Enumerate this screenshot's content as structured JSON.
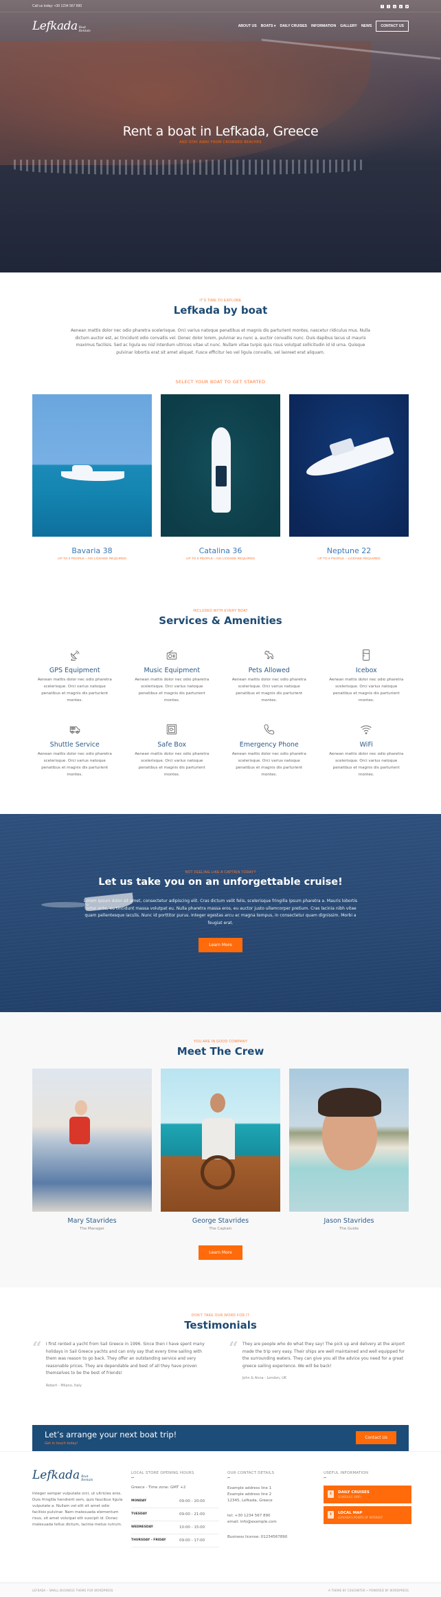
{
  "topbar": {
    "call": "Call us today: +30 1234 567 890",
    "socials": [
      "facebook-icon",
      "twitter-icon",
      "instagram-icon",
      "youtube-icon",
      "email-icon"
    ]
  },
  "brand": {
    "main": "Lefkada",
    "sub1": "Boat",
    "sub2": "Rentals"
  },
  "nav": {
    "items": [
      "ABOUT US",
      "BOATS",
      "DAILY CRUISES",
      "INFORMATION",
      "GALLERY",
      "NEWS"
    ],
    "boats_caret": "▾",
    "contact": "CONTACT US"
  },
  "hero": {
    "title": "Rent a boat in Lefkada, Greece",
    "subtitle": "AND STAY AWAY FROM CROWDED BEACHES"
  },
  "explore": {
    "kicker": "IT'S TIME TO EXPLORE",
    "title": "Lefkada by boat",
    "lead": "Aenean mattis dolor nec odio pharetra scelerisque. Orci varius natoque penatibus et magnis dis parturient montes, nascetur ridiculus mus. Nulla dictum auctor est, ac tincidunt odio convallis vel. Donec dolor lorem, pulvinar eu nunc a, auctor convallis nunc. Duis dapibus lacus ut mauris maximus facilisis. Sed ac ligula eu nisl interdum ultrices vitae ut nunc. Nullam vitae turpis quis risus volutpat sollicitudin id id urna. Quisque pulvinar lobortis erat sit amet aliquet. Fusce efficitur leo vel ligula convallis, vel laoreet erat aliquam.",
    "select": "SELECT YOUR BOAT TO GET STARTED",
    "boats": [
      {
        "name": "Bavaria 38",
        "meta": "UP TO 5 PEOPLE – NO LICENSE REQUIRED"
      },
      {
        "name": "Catalina 36",
        "meta": "UP TO 6 PEOPLE – NO LICENSE REQUIRED"
      },
      {
        "name": "Neptune 22",
        "meta": "UP TO 6 PEOPLE – LICENSE REQUIRED"
      }
    ]
  },
  "services": {
    "kicker": "INCLUDED WITH EVERY BOAT",
    "title": "Services & Amenities",
    "items": [
      {
        "title": "GPS Equipment",
        "icon": "satellite-dish-icon",
        "text": "Aenean mattis dolor nec odio pharetra scelerisque. Orci varius natoque penatibus et magnis dis parturient montes."
      },
      {
        "title": "Music Equipment",
        "icon": "radio-icon",
        "text": "Aenean mattis dolor nec odio pharetra scelerisque. Orci varius natoque penatibus et magnis dis parturient montes."
      },
      {
        "title": "Pets Allowed",
        "icon": "dog-icon",
        "text": "Aenean mattis dolor nec odio pharetra scelerisque. Orci varius natoque penatibus et magnis dis parturient montes."
      },
      {
        "title": "Icebox",
        "icon": "fridge-icon",
        "text": "Aenean mattis dolor nec odio pharetra scelerisque. Orci varius natoque penatibus et magnis dis parturient montes."
      },
      {
        "title": "Shuttle Service",
        "icon": "van-icon",
        "text": "Aenean mattis dolor nec odio pharetra scelerisque. Orci varius natoque penatibus et magnis dis parturient montes."
      },
      {
        "title": "Safe Box",
        "icon": "safe-icon",
        "text": "Aenean mattis dolor nec odio pharetra scelerisque. Orci varius natoque penatibus et magnis dis parturient montes."
      },
      {
        "title": "Emergency Phone",
        "icon": "phone-icon",
        "text": "Aenean mattis dolor nec odio pharetra scelerisque. Orci varius natoque penatibus et magnis dis parturient montes."
      },
      {
        "title": "WiFi",
        "icon": "wifi-icon",
        "text": "Aenean mattis dolor nec odio pharetra scelerisque. Orci varius natoque penatibus et magnis dis parturient montes."
      }
    ]
  },
  "cruise": {
    "kicker": "NOT FEELING LIKE A CAPTAIN TODAY?",
    "title": "Let us take you on an unforgettable cruise!",
    "body": "Lorem ipsum dolor sit amet, consectetur adipiscing elit. Cras dictum velit felis, scelerisque fringilla ipsum pharetra a. Mauris lobortis tortor ante, eu tincidunt massa volutpat eu. Nulla pharetra massa eros, eu auctor justo ullamcorper pretium. Cras lacinia nibh vitae quam pellentesque iaculis. Nunc id porttitor purus. Integer egestas arcu ac magna tempus, in consectetur quam dignissim. Morbi a feugiat erat.",
    "button": "Learn More"
  },
  "crew": {
    "kicker": "YOU ARE IN GOOD COMPANY",
    "title": "Meet The Crew",
    "members": [
      {
        "name": "Mary Stavrides",
        "role": "The Manager"
      },
      {
        "name": "George Stavrides",
        "role": "The Captain"
      },
      {
        "name": "Jason Stavrides",
        "role": "The Guide"
      }
    ],
    "button": "Learn More"
  },
  "testimonials": {
    "kicker": "DON'T TAKE OUR WORD FOR IT",
    "title": "Testimonials",
    "items": [
      {
        "text": "I first rented a yacht from Sail Greece in 1996. Since then I have spent many holidays in Sail Greece yachts and can only say that every time sailing with them was reason to go back. They offer an outstanding service and very reasonable prices. They are dependable and best of all they have proven themselves to be the best of friends!",
        "by": "Robert - Milano, Italy"
      },
      {
        "text": "They are people who do what they say! The pick up and delivery at the airport made the trip very easy. Their ships are well maintained and well equipped for the surrounding waters. They can give you all the advice you need for a great greece sailing experience. We will be back!",
        "by": "John & Anna - London, UK"
      }
    ]
  },
  "cta": {
    "title": "Let’s arrange your next boat trip!",
    "sub": "Get in touch today!",
    "button": "Contact Us"
  },
  "footer": {
    "about": "Integer semper vulputate orci, ut ultricies eros. Duis fringilla hendrerit sem, quis faucibus ligula vulputate a. Nullam vel elit sit amet odio facilisis pulvinar. Nam malesuada elementum risus, sit amet volutpat elit suscipit id. Donec malesuada tellus dictum, lacinia metus rutrum.",
    "hours_title": "LOCAL STORE OPENING HOURS",
    "timezone": "Greece - Time zone: GMT +2",
    "hours": [
      {
        "day": "MONDAY",
        "time": "09:00 - 20:00"
      },
      {
        "day": "TUESDAY",
        "time": "09:00 - 21:00"
      },
      {
        "day": "WEDNESDAY",
        "time": "10:00 - 15:00"
      },
      {
        "day": "THURSDAY - FRIDAY",
        "time": "09:00 - 17:00"
      }
    ],
    "contact_title": "OUR CONTACT DETAILS",
    "address": [
      "Example address line 1",
      "Example address line 2",
      "12345, Lefkada, Greece"
    ],
    "tel": "tel: +30 1234 567 890",
    "email": "email: info@example.com",
    "license": "Business license: 01234567890",
    "useful_title": "USEFUL INFORMATION",
    "useful": [
      {
        "title": "DAILY CRUISES",
        "sub": "SCHEDULE (PDF)"
      },
      {
        "title": "LOCAL MAP",
        "sub": "LEFKADA'S POINTS OF INTEREST"
      }
    ],
    "pdf_glyph": "⬇",
    "bottom_left": "LEFKADA – SMALL BUSINESS THEME FOR WORDPRESS",
    "bottom_right": "A THEME BY CSSIGNITER • POWERED BY WORDPRESS"
  },
  "colors": {
    "accent": "#ff6a0a",
    "navy": "#1c4c78",
    "heading": "#1d4a73",
    "link": "#3b78b7"
  }
}
